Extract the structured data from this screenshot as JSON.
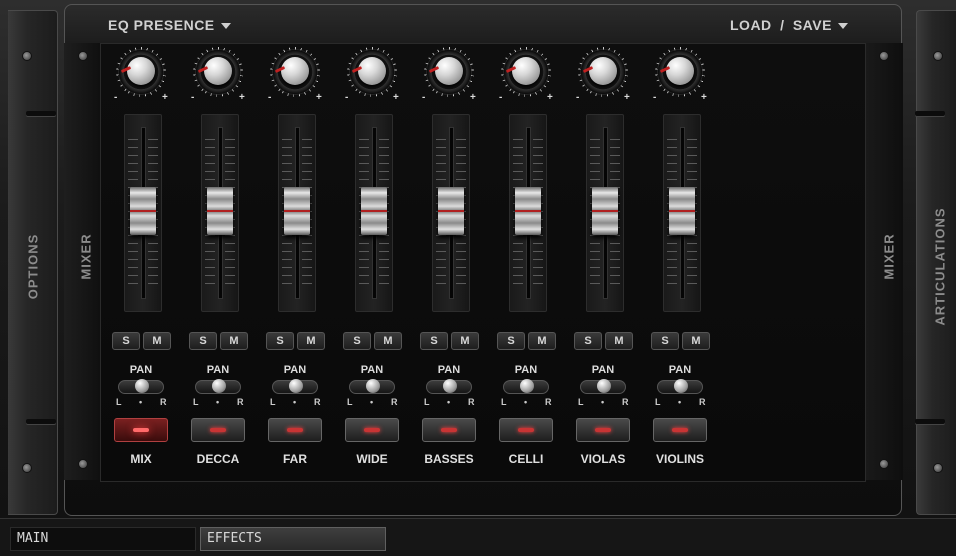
{
  "header": {
    "preset_label": "EQ PRESENCE",
    "load_label": "LOAD",
    "slash": "/",
    "save_label": "SAVE"
  },
  "side_labels": {
    "options": "OPTIONS",
    "mixer_left": "MIXER",
    "mixer_right": "MIXER",
    "articulations": "ARTICULATIONS"
  },
  "channel_controls": {
    "solo": "S",
    "mute": "M",
    "pan": "PAN",
    "pan_left": "L",
    "pan_center": "•",
    "pan_right": "R",
    "minus": "-",
    "plus": "+"
  },
  "channels": [
    {
      "name": "MIX",
      "active": true
    },
    {
      "name": "DECCA",
      "active": false
    },
    {
      "name": "FAR",
      "active": false
    },
    {
      "name": "WIDE",
      "active": false
    },
    {
      "name": "BASSES",
      "active": false
    },
    {
      "name": "CELLI",
      "active": false
    },
    {
      "name": "VIOLAS",
      "active": false
    },
    {
      "name": "VIOLINS",
      "active": false
    }
  ],
  "tabs": {
    "main": "MAIN",
    "effects": "EFFECTS"
  },
  "colors": {
    "accent_red": "#c83434",
    "panel_dark": "#0d0d0d",
    "text": "#d8d8d8"
  }
}
